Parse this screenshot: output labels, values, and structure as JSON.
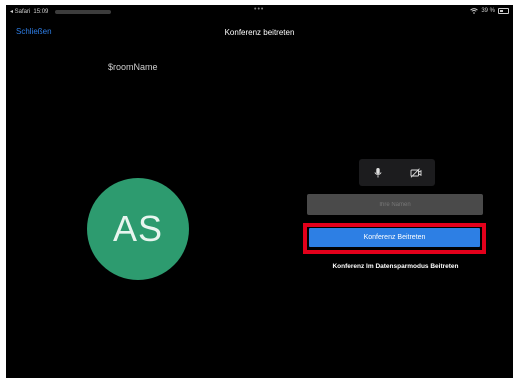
{
  "status_bar": {
    "app": "◂ Safari",
    "time": "15:09",
    "date": "Mittwoch 19. Aug.",
    "dots": "•••",
    "battery": "39 %"
  },
  "nav": {
    "close_label": "Schließen",
    "title": "Konferenz beitreten"
  },
  "room_name": "$roomName",
  "avatar_initials": "AS",
  "name_input": {
    "placeholder": "Ihre Namen",
    "value": ""
  },
  "join_button_label": "Konferenz Beitreten",
  "low_bandwidth_label": "Konferenz Im Datensparmodus Beitreten",
  "colors": {
    "accent": "#2d7fe4",
    "avatar": "#2d9b6f",
    "highlight": "#e3001b"
  },
  "icons": [
    "microphone-icon",
    "video-off-icon",
    "wifi-icon",
    "battery-icon"
  ]
}
